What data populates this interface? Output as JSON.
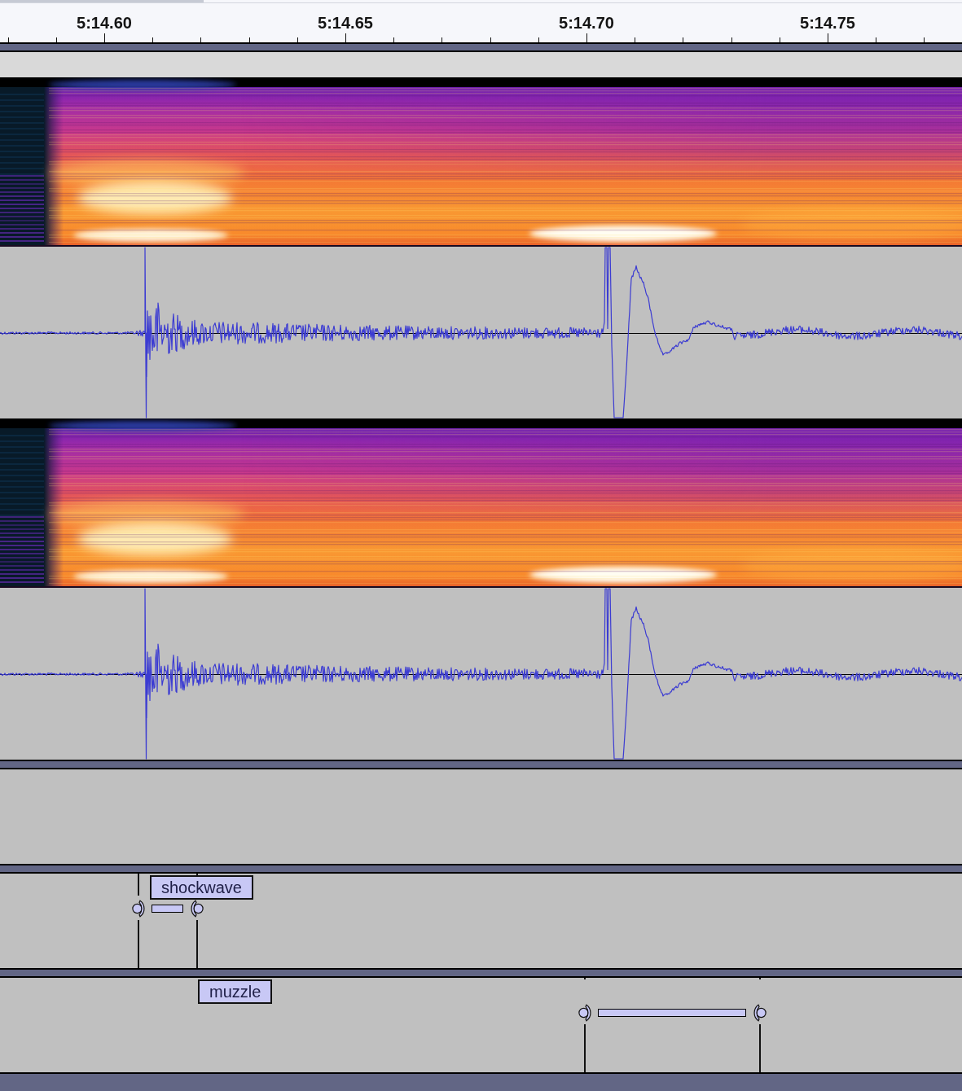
{
  "ruler": {
    "labels": [
      "5:14.60",
      "5:14.65",
      "5:14.70",
      "5:14.75"
    ]
  },
  "tracks": [
    {
      "kind": "audio",
      "channels": [
        {
          "views": [
            {
              "kind": "spectrogram"
            },
            {
              "kind": "waveform"
            }
          ]
        },
        {
          "views": [
            {
              "kind": "spectrogram"
            },
            {
              "kind": "waveform"
            }
          ]
        }
      ]
    },
    {
      "kind": "empty"
    },
    {
      "kind": "label",
      "labels": [
        {
          "text": "shockwave"
        }
      ]
    },
    {
      "kind": "label",
      "labels": [
        {
          "text": "muzzle"
        }
      ]
    }
  ]
}
